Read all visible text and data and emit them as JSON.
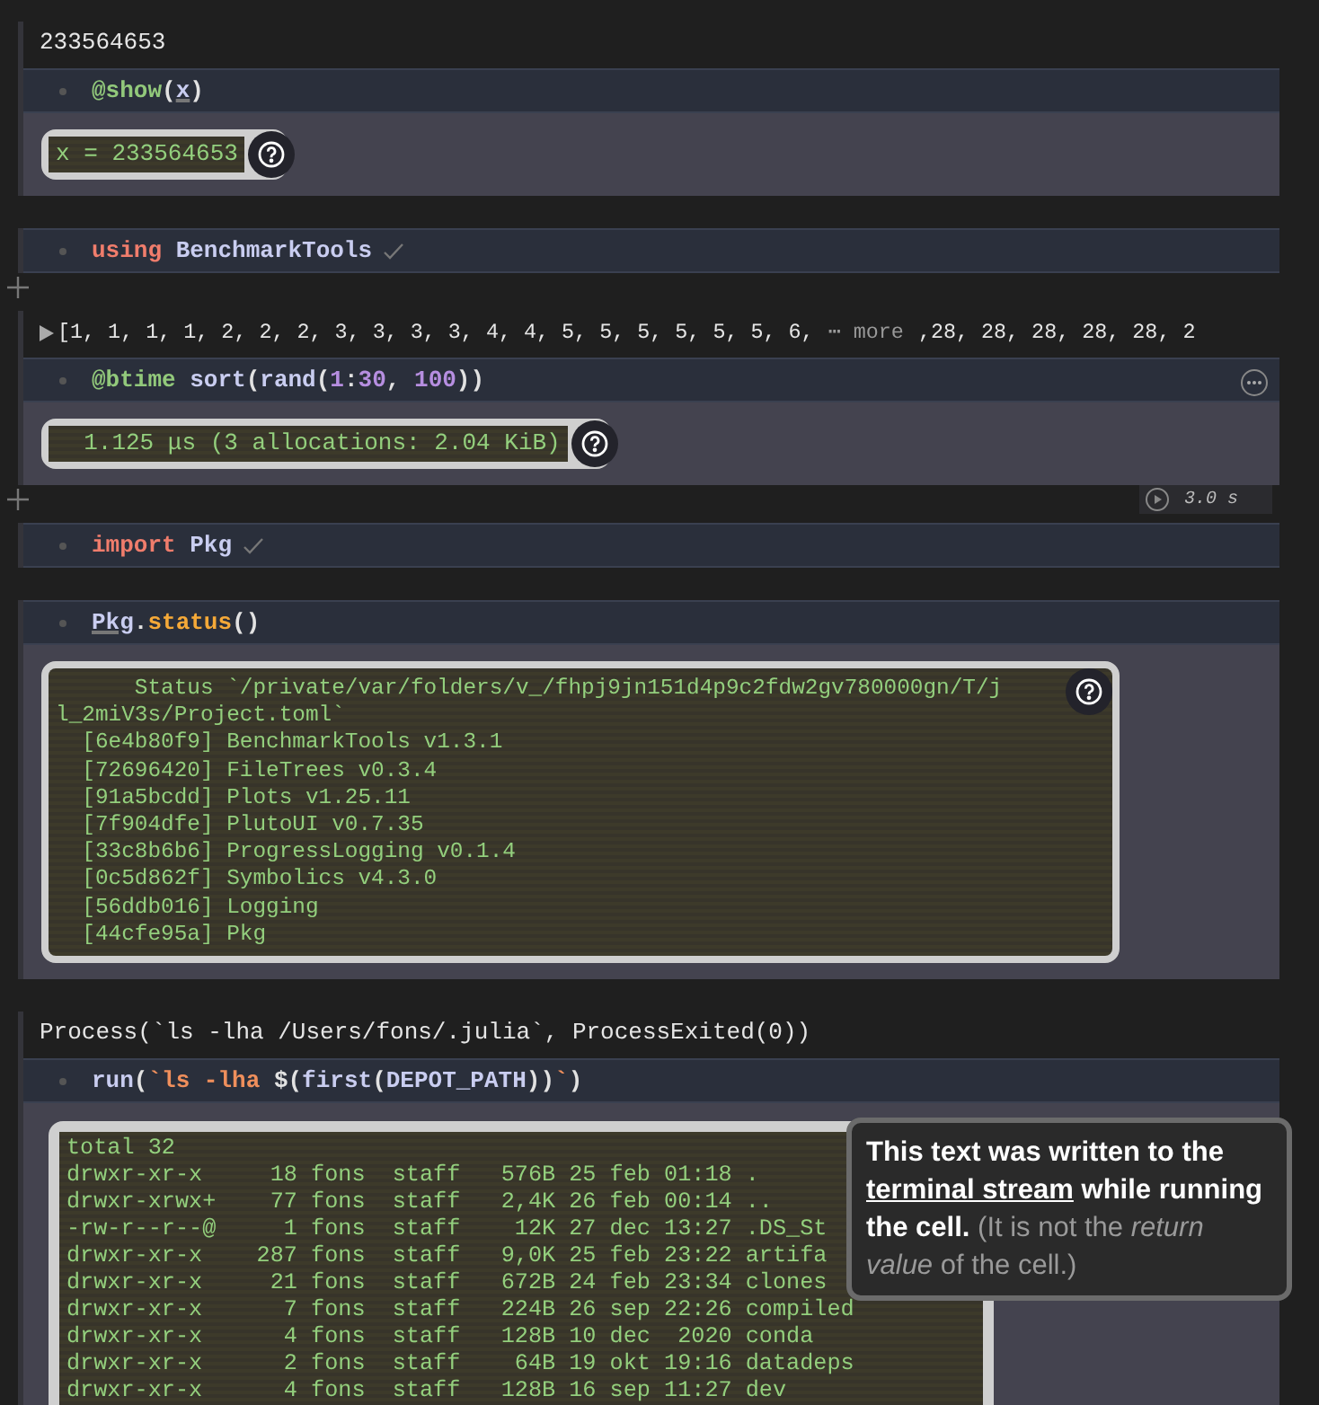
{
  "cells": [
    {
      "result": {
        "kind": "text",
        "text": "233564653"
      },
      "code": [
        {
          "kind": "macro",
          "text": "@show"
        },
        {
          "kind": "plain",
          "text": "("
        },
        {
          "kind": "ref",
          "text": "x"
        },
        {
          "kind": "plain",
          "text": ")"
        }
      ],
      "log": {
        "kind": "inline",
        "lines": [
          "x = 233564653"
        ]
      }
    },
    {
      "code": [
        {
          "kind": "keyword",
          "text": "using"
        },
        {
          "kind": "name",
          "text": " BenchmarkTools"
        }
      ],
      "done": true,
      "insert_mark": true
    },
    {
      "result": {
        "kind": "array",
        "expanded": false,
        "head": "[1, 1, 1, 1, 2, 2, 2, 3, 3, 3, 3, 4, 4, 5, 5, 5, 5, 5, 5, 6,",
        "more": "⋯ more",
        "tail": ",28, 28, 28, 28, 28, 2"
      },
      "code": [
        {
          "kind": "macro",
          "text": "@btime"
        },
        {
          "kind": "name",
          "text": " sort"
        },
        {
          "kind": "plain",
          "text": "("
        },
        {
          "kind": "name",
          "text": "rand"
        },
        {
          "kind": "plain",
          "text": "("
        },
        {
          "kind": "number",
          "text": "1"
        },
        {
          "kind": "plain",
          "text": ":"
        },
        {
          "kind": "number",
          "text": "30"
        },
        {
          "kind": "plain",
          "text": ", "
        },
        {
          "kind": "number",
          "text": "100"
        },
        {
          "kind": "plain",
          "text": "))"
        }
      ],
      "show_menu": true,
      "log": {
        "kind": "inline",
        "lines": [
          "  1.125 μs (3 allocations: 2.04 KiB)"
        ]
      },
      "insert_mark": true,
      "runtime": "3.0 s"
    },
    {
      "code": [
        {
          "kind": "keyword",
          "text": "import"
        },
        {
          "kind": "name",
          "text": " Pkg"
        }
      ],
      "done": true
    },
    {
      "code": [
        {
          "kind": "ref",
          "text": "Pkg"
        },
        {
          "kind": "plain",
          "text": "."
        },
        {
          "kind": "method",
          "text": "status"
        },
        {
          "kind": "plain",
          "text": "()"
        }
      ],
      "log": {
        "kind": "block",
        "lines": [
          "      Status `/private/var/folders/v_/fhpj9jn151d4p9c2fdw2gv780000gn/T/j",
          "l_2miV3s/Project.toml`",
          "  [6e4b80f9] BenchmarkTools v1.3.1",
          "  [72696420] FileTrees v0.3.4",
          "  [91a5bcdd] Plots v1.25.11",
          "  [7f904dfe] PlutoUI v0.7.35",
          "  [33c8b6b6] ProgressLogging v0.1.4",
          "  [0c5d862f] Symbolics v4.3.0",
          "  [56ddb016] Logging",
          "  [44cfe95a] Pkg"
        ]
      }
    },
    {
      "result": {
        "kind": "text",
        "text": "Process(`ls -lha /Users/fons/.julia`, ProcessExited(0))"
      },
      "code": [
        {
          "kind": "name",
          "text": "run"
        },
        {
          "kind": "plain",
          "text": "("
        },
        {
          "kind": "string",
          "text": "`ls -lha "
        },
        {
          "kind": "plain",
          "text": "$("
        },
        {
          "kind": "name",
          "text": "first"
        },
        {
          "kind": "plain",
          "text": "("
        },
        {
          "kind": "name",
          "text": "DEPOT_PATH"
        },
        {
          "kind": "plain",
          "text": "))"
        },
        {
          "kind": "string",
          "text": "`"
        },
        {
          "kind": "plain",
          "text": ")"
        }
      ],
      "log": {
        "kind": "terminal",
        "lines": [
          "total 32",
          "drwxr-xr-x     18 fons  staff   576B 25 feb 01:18 .",
          "drwxr-xrwx+    77 fons  staff   2,4K 26 feb 00:14 ..",
          "-rw-r--r--@     1 fons  staff    12K 27 dec 13:27 .DS_St",
          "drwxr-xr-x    287 fons  staff   9,0K 25 feb 23:22 artifa",
          "drwxr-xr-x     21 fons  staff   672B 24 feb 23:34 clones",
          "drwxr-xr-x      7 fons  staff   224B 26 sep 22:26 compiled",
          "drwxr-xr-x      4 fons  staff   128B 10 dec  2020 conda",
          "drwxr-xr-x      2 fons  staff    64B 19 okt 19:16 datadeps",
          "drwxr-xr-x      4 fons  staff   128B 16 sep 11:27 dev"
        ],
        "tooltip": {
          "intro": "This text was written to the ",
          "link": "terminal stream",
          "rest": " while running the cell.",
          "note": "(It is not the *return value* of the cell.)"
        }
      }
    }
  ]
}
